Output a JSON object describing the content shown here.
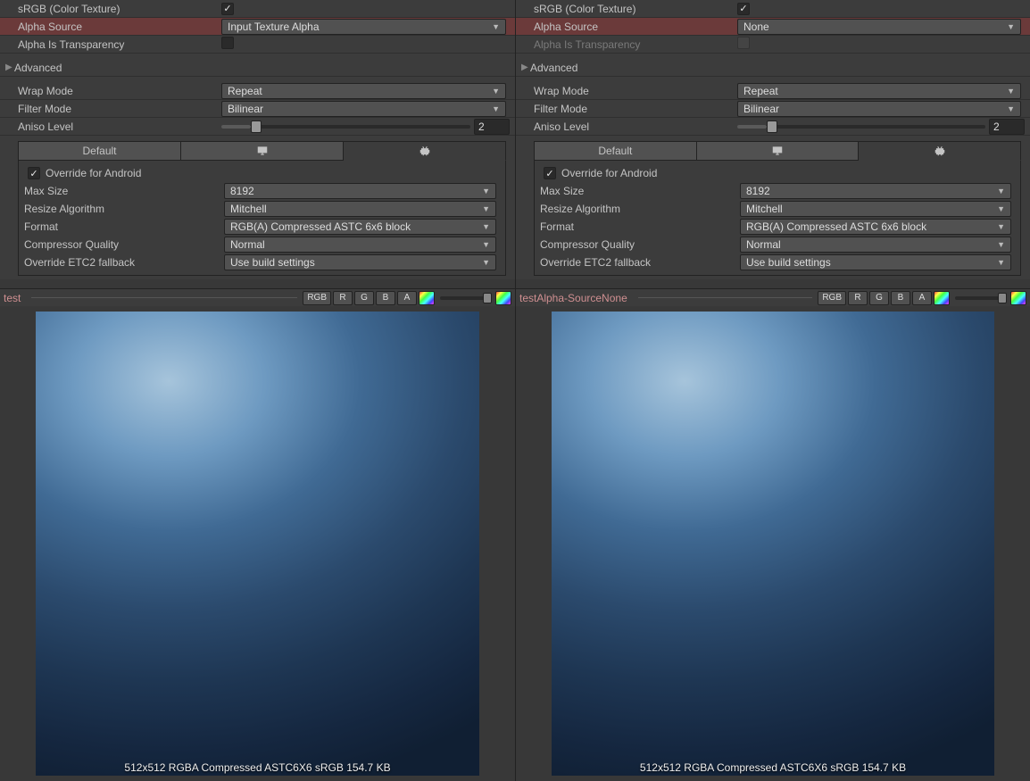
{
  "labels": {
    "srgb": "sRGB (Color Texture)",
    "alphaSource": "Alpha Source",
    "alphaIsTransparency": "Alpha Is Transparency",
    "advanced": "Advanced",
    "wrapMode": "Wrap Mode",
    "filterMode": "Filter Mode",
    "anisoLevel": "Aniso Level",
    "default": "Default",
    "override": "Override for Android",
    "maxSize": "Max Size",
    "resizeAlg": "Resize Algorithm",
    "format": "Format",
    "compQuality": "Compressor Quality",
    "etc2": "Override ETC2 fallback"
  },
  "channels": {
    "rgb": "RGB",
    "r": "R",
    "g": "G",
    "b": "B",
    "a": "A"
  },
  "left": {
    "srgb": true,
    "alphaSource": "Input Texture Alpha",
    "alphaIsTransparency": false,
    "wrapMode": "Repeat",
    "filterMode": "Bilinear",
    "anisoLevel": 2,
    "anisoSliderPct": 12,
    "activePlatformTab": 2,
    "override": true,
    "maxSize": "8192",
    "resizeAlg": "Mitchell",
    "format": "RGB(A) Compressed ASTC 6x6 block",
    "compQuality": "Normal",
    "etc2": "Use build settings",
    "previewName": "test",
    "miniSliderPct": 85,
    "caption": "512x512  RGBA Compressed ASTC6X6 sRGB   154.7 KB"
  },
  "right": {
    "srgb": true,
    "alphaSource": "None",
    "alphaIsTransparency": false,
    "wrapMode": "Repeat",
    "filterMode": "Bilinear",
    "anisoLevel": 2,
    "anisoSliderPct": 12,
    "activePlatformTab": 2,
    "override": true,
    "maxSize": "8192",
    "resizeAlg": "Mitchell",
    "format": "RGB(A) Compressed ASTC 6x6 block",
    "compQuality": "Normal",
    "etc2": "Use build settings",
    "previewName": "testAlpha-SourceNone",
    "miniSliderPct": 85,
    "caption": "512x512  RGBA Compressed ASTC6X6 sRGB   154.7 KB"
  }
}
